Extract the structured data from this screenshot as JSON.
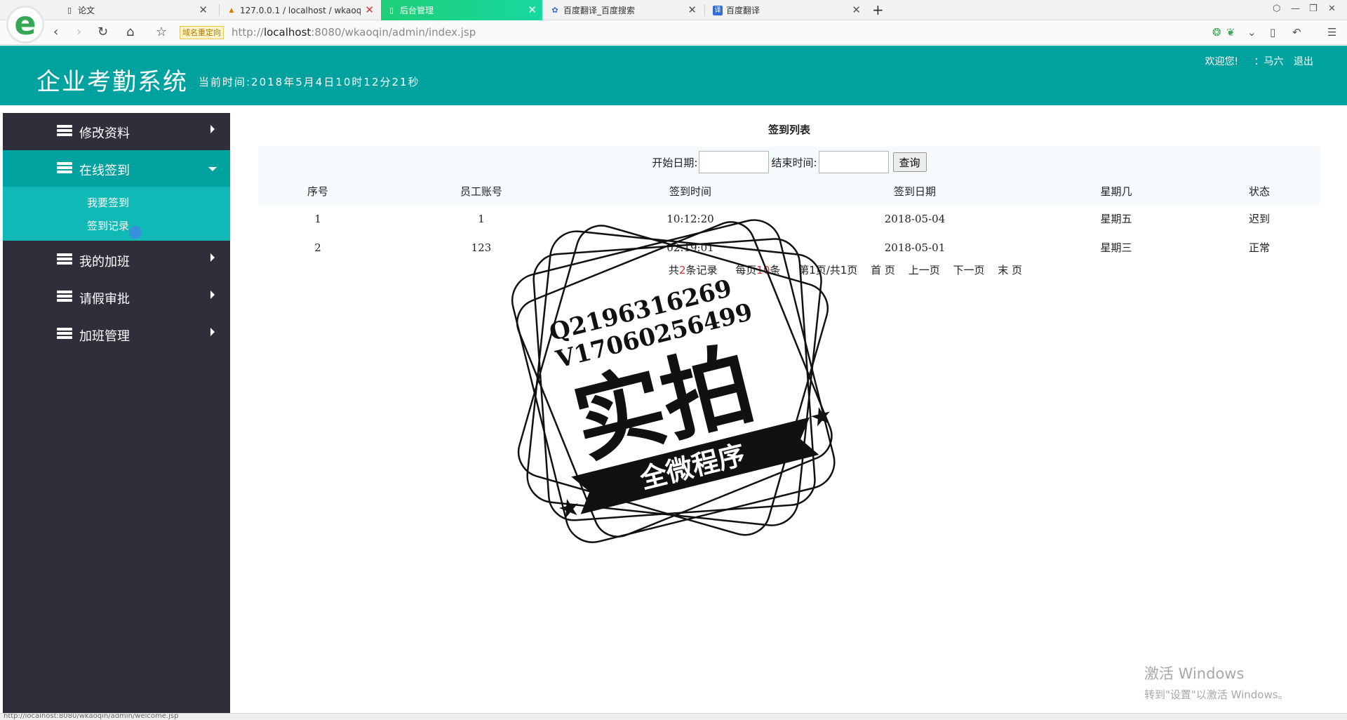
{
  "browser": {
    "tabs": [
      {
        "label": "论文",
        "icon": "document-icon"
      },
      {
        "label": "127.0.0.1 / localhost / wkaoqin",
        "icon": "phpmyadmin-icon"
      },
      {
        "label": "后台管理",
        "icon": "page-icon",
        "active": true
      },
      {
        "label": "百度翻译_百度搜索",
        "icon": "baidu-paw-icon"
      },
      {
        "label": "百度翻译",
        "icon": "baidu-translate-icon"
      }
    ],
    "redirect_badge": "域名重定向",
    "url_prefix": "http://",
    "url_host": "localhost",
    "url_rest": ":8080/wkaoqin/admin/index.jsp"
  },
  "header": {
    "title": "企业考勤系统",
    "time_label": "当前时间:2018年5月4日10时12分21秒",
    "welcome": "欢迎您!",
    "username": "：马六",
    "logout": "退出"
  },
  "sidebar": {
    "items": [
      {
        "label": "修改资料"
      },
      {
        "label": "在线签到",
        "open": true
      },
      {
        "label": "我的加班"
      },
      {
        "label": "请假审批"
      },
      {
        "label": "加班管理"
      }
    ],
    "submenu": [
      "我要签到",
      "签到记录"
    ]
  },
  "main": {
    "title": "签到列表",
    "search": {
      "start_label": "开始日期:",
      "end_label": "结束时间:",
      "query_button": "查询"
    },
    "columns": [
      "序号",
      "员工账号",
      "签到时间",
      "签到日期",
      "星期几",
      "状态"
    ],
    "rows": [
      [
        "1",
        "1",
        "10:12:20",
        "2018-05-04",
        "星期五",
        "迟到"
      ],
      [
        "2",
        "123",
        "02:19:01",
        "2018-05-01",
        "星期三",
        "正常"
      ]
    ],
    "pager": {
      "total_prefix": "共",
      "total_count": "2",
      "total_suffix": "条记录",
      "per_page_prefix": "每页",
      "per_page": "10",
      "per_page_suffix": "条",
      "page_info": "第1页/共1页",
      "first": "首  页",
      "prev": "上一页",
      "next": "下一页",
      "last": "末  页"
    }
  },
  "watermark": {
    "line1": "Q2196316269",
    "line2": "V17060256499",
    "big": "实拍",
    "ribbon": "全微程序"
  },
  "windows_activation": {
    "line1": "激活 Windows",
    "line2": "转到\"设置\"以激活 Windows。"
  },
  "statusbar": "http://localhost:8080/wkaoqin/admin/welcome.jsp"
}
